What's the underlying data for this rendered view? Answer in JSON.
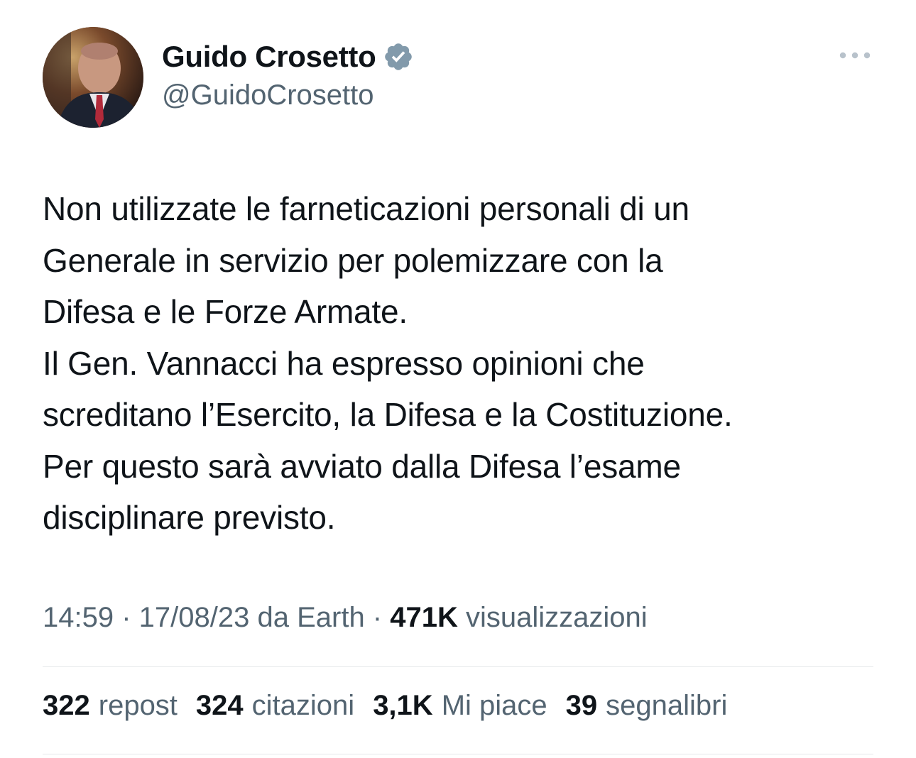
{
  "author": {
    "display_name": "Guido Crosetto",
    "handle": "@GuidoCrosetto",
    "verified": true,
    "avatar_icon": "profile-photo"
  },
  "more_icon": "ellipsis-icon",
  "tweet": {
    "lines": [
      "Non utilizzate le farneticazioni personali di un",
      "Generale in servizio per polemizzare con la",
      "Difesa e le Forze Armate.",
      "Il Gen. Vannacci ha espresso opinioni che",
      "screditano l’Esercito, la Difesa e la Costituzione.",
      "Per questo sarà avviato dalla Difesa l’esame",
      "disciplinare previsto."
    ]
  },
  "meta": {
    "time": "14:59",
    "sep1": " · ",
    "date": "17/08/23",
    "source": " da Earth",
    "sep2": " · ",
    "views_count": "471K",
    "views_label": " visualizzazioni"
  },
  "stats": {
    "reposts": {
      "count": "322",
      "label": "repost"
    },
    "quotes": {
      "count": "324",
      "label": "citazioni"
    },
    "likes": {
      "count": "3,1K",
      "label": "Mi piace"
    },
    "bookmarks": {
      "count": "39",
      "label": "segnalibri"
    }
  },
  "colors": {
    "primary_text": "#0f1419",
    "secondary_text": "#536471",
    "verified_badge": "#829aab",
    "divider": "#e6e8ea"
  }
}
